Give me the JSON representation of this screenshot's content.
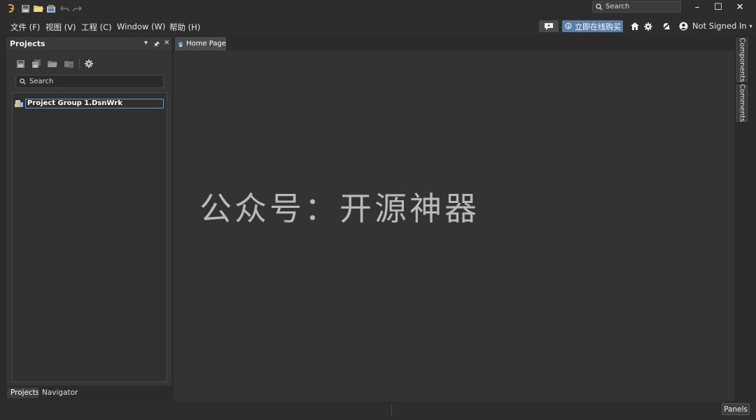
{
  "titlebar": {
    "quick_access_icons": [
      "app-logo-icon",
      "save-all-icon",
      "open-folder-icon",
      "open-project-icon",
      "undo-icon",
      "redo-icon"
    ],
    "search_placeholder": "Search",
    "window_buttons": {
      "minimize": "–",
      "maximize": "☐",
      "close": "✕"
    }
  },
  "menubar": {
    "items": [
      {
        "label": "文件 (F)"
      },
      {
        "label": "视图 (V)"
      },
      {
        "label": "工程 (C)"
      },
      {
        "label": "Window (W)"
      },
      {
        "label": "帮助 (H)"
      }
    ],
    "buy_online_label": "立即在线购买",
    "user_label": "Not Signed In",
    "right_icons": [
      "feedback-icon",
      "home-icon",
      "gear-icon",
      "notifications-off-icon",
      "user-icon"
    ]
  },
  "projects_panel": {
    "title": "Projects",
    "header_controls": [
      "▾",
      "🖈",
      "✕"
    ],
    "toolbar_icons": [
      "save-icon",
      "save-all-icon",
      "open-icon",
      "close-project-icon",
      "settings-icon"
    ],
    "search_placeholder": "Search",
    "tree": [
      {
        "label": "Project Group 1.DsnWrk",
        "icon": "project-group-icon"
      }
    ],
    "tabs": [
      {
        "label": "Projects",
        "active": true
      },
      {
        "label": "Navigator",
        "active": false
      }
    ]
  },
  "document": {
    "tab_label": "Home Page",
    "watermark": "公众号：开源神器"
  },
  "right_rail": {
    "tabs": [
      {
        "label": "Components"
      },
      {
        "label": "Comments"
      }
    ]
  },
  "statusbar": {
    "panels_label": "Panels"
  },
  "colors": {
    "background": "#2b2b2b",
    "panel": "#353535",
    "document": "#333333",
    "accent_buy": "#5a7ea6",
    "selection_border": "#6d96c4"
  }
}
